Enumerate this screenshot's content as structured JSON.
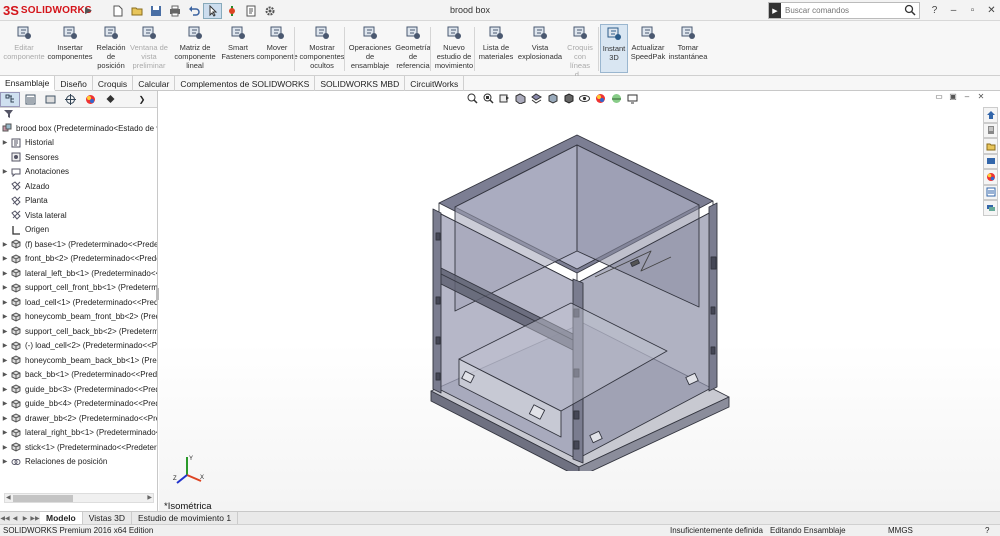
{
  "app": {
    "logo": "SOLIDWORKS",
    "window_title": "brood box",
    "search_placeholder": "Buscar comandos"
  },
  "ribbon": [
    {
      "line1": "Editar",
      "line2": "componente",
      "line3": "",
      "icon": "edit-component-icon",
      "enabled": false
    },
    {
      "line1": "Insertar",
      "line2": "componentes",
      "line3": "",
      "icon": "insert-components-icon",
      "enabled": true
    },
    {
      "line1": "Relación",
      "line2": "de",
      "line3": "posición",
      "icon": "mate-icon",
      "enabled": true
    },
    {
      "line1": "Ventana de",
      "line2": "vista",
      "line3": "preliminar ...",
      "icon": "preview-window-icon",
      "enabled": false
    },
    {
      "line1": "Matriz de",
      "line2": "componente",
      "line3": "lineal",
      "icon": "linear-pattern-icon",
      "enabled": true
    },
    {
      "line1": "Smart",
      "line2": "Fasteners",
      "line3": "",
      "icon": "smart-fasteners-icon",
      "enabled": true
    },
    {
      "line1": "Mover",
      "line2": "componente",
      "line3": "",
      "icon": "move-component-icon",
      "enabled": true
    },
    {
      "line1": "Mostrar",
      "line2": "componentes",
      "line3": "ocultos",
      "icon": "show-hidden-icon",
      "enabled": true
    },
    {
      "line1": "Operaciones",
      "line2": "de",
      "line3": "ensamblaje",
      "icon": "assembly-features-icon",
      "enabled": true
    },
    {
      "line1": "Geometría",
      "line2": "de",
      "line3": "referencia",
      "icon": "reference-geometry-icon",
      "enabled": true
    },
    {
      "line1": "Nuevo",
      "line2": "estudio de",
      "line3": "movimiento",
      "icon": "motion-study-icon",
      "enabled": true
    },
    {
      "line1": "Lista de",
      "line2": "materiales",
      "line3": "",
      "icon": "bom-icon",
      "enabled": true
    },
    {
      "line1": "Vista",
      "line2": "explosionada",
      "line3": "",
      "icon": "exploded-view-icon",
      "enabled": true
    },
    {
      "line1": "Croquis",
      "line2": "con",
      "line3": "líneas d...",
      "icon": "explode-line-sketch-icon",
      "enabled": false
    },
    {
      "line1": "Instant",
      "line2": "3D",
      "line3": "",
      "icon": "instant3d-icon",
      "enabled": true,
      "active": true
    },
    {
      "line1": "Actualizar",
      "line2": "SpeedPak",
      "line3": "",
      "icon": "speedpak-icon",
      "enabled": true
    },
    {
      "line1": "Tomar",
      "line2": "instantánea",
      "line3": "",
      "icon": "snapshot-icon",
      "enabled": true
    }
  ],
  "tabs": [
    "Ensamblaje",
    "Diseño",
    "Croquis",
    "Calcular",
    "Complementos de SOLIDWORKS",
    "SOLIDWORKS MBD",
    "CircuitWorks"
  ],
  "active_tab": "Ensamblaje",
  "tree": [
    {
      "label": "brood box  (Predeterminado<Estado de visualización-1>)",
      "icon": "assembly-icon",
      "arrow": false,
      "root": true
    },
    {
      "label": "Historial",
      "icon": "history-icon",
      "arrow": true
    },
    {
      "label": "Sensores",
      "icon": "sensors-icon",
      "arrow": false
    },
    {
      "label": "Anotaciones",
      "icon": "annotations-icon",
      "arrow": true
    },
    {
      "label": "Alzado",
      "icon": "plane-icon",
      "arrow": false
    },
    {
      "label": "Planta",
      "icon": "plane-icon",
      "arrow": false
    },
    {
      "label": "Vista lateral",
      "icon": "plane-icon",
      "arrow": false
    },
    {
      "label": "Origen",
      "icon": "origin-icon",
      "arrow": false
    },
    {
      "label": "(f) base<1> (Predeterminado<<Predeterminado>_Estado de visualización 1>)",
      "icon": "part-icon",
      "arrow": true
    },
    {
      "label": "front_bb<2> (Predeterminado<<Predeterminado>_Estado de visualización 1>)",
      "icon": "part-icon",
      "arrow": true
    },
    {
      "label": "lateral_left_bb<1> (Predeterminado<<Predeterminado>_Estado de visualización 1>)",
      "icon": "part-icon",
      "arrow": true
    },
    {
      "label": "support_cell_front_bb<1> (Predeterminado<<Predeterminado>_Estado de visualización 1>)",
      "icon": "part-icon",
      "arrow": true
    },
    {
      "label": "load_cell<1> (Predeterminado<<Predeterminado>_Estado de visualización 1>)",
      "icon": "part-icon",
      "arrow": true
    },
    {
      "label": "honeycomb_beam_front_bb<2> (Predeterminado<<Predeterminado>_Estado de visualización 1>)",
      "icon": "part-icon",
      "arrow": true
    },
    {
      "label": "support_cell_back_bb<2> (Predeterminado<<Predeterminado>_Estado de visualización 1>)",
      "icon": "part-icon",
      "arrow": true
    },
    {
      "label": "(-) load_cell<2> (Predeterminado<<Predeterminado>_Estado de visualización 1>)",
      "icon": "part-icon",
      "arrow": true
    },
    {
      "label": "honeycomb_beam_back_bb<1> (Predeterminado<<Predeterminado>_Estado de visualización 1>)",
      "icon": "part-icon",
      "arrow": true
    },
    {
      "label": "back_bb<1> (Predeterminado<<Predeterminado>_Estado de visualización 1>)",
      "icon": "part-icon",
      "arrow": true
    },
    {
      "label": "guide_bb<3> (Predeterminado<<Predeterminado>_Estado de visualización 1>)",
      "icon": "part-icon",
      "arrow": true
    },
    {
      "label": "guide_bb<4> (Predeterminado<<Predeterminado>_Estado de visualización 1>)",
      "icon": "part-icon",
      "arrow": true
    },
    {
      "label": "drawer_bb<2> (Predeterminado<<Predeterminado>_Estado de visualización 1>)",
      "icon": "part-icon",
      "arrow": true
    },
    {
      "label": "lateral_right_bb<1> (Predeterminado<<Predeterminado>_Estado de visualización 1>)",
      "icon": "part-icon",
      "arrow": true
    },
    {
      "label": "stick<1> (Predeterminado<<Predeterminado>_Estado de visualización 1>)",
      "icon": "part-icon",
      "arrow": true
    },
    {
      "label": "Relaciones de posición",
      "icon": "mates-icon",
      "arrow": true
    }
  ],
  "viewport": {
    "view_name": "*Isométrica",
    "triad": {
      "x": "X",
      "y": "Y",
      "z": "Z"
    }
  },
  "bottom_tabs": [
    "Modelo",
    "Vistas 3D",
    "Estudio de movimiento 1"
  ],
  "active_bottom_tab": "Modelo",
  "status": {
    "edition": "SOLIDWORKS Premium 2016 x64 Edition",
    "definition": "Insuficientemente definida",
    "mode": "Editando Ensamblaje",
    "units": "MMGS"
  },
  "colors": {
    "accent": "#d4141a",
    "model_body": "#8c8fa8",
    "model_edge": "#33353f"
  }
}
